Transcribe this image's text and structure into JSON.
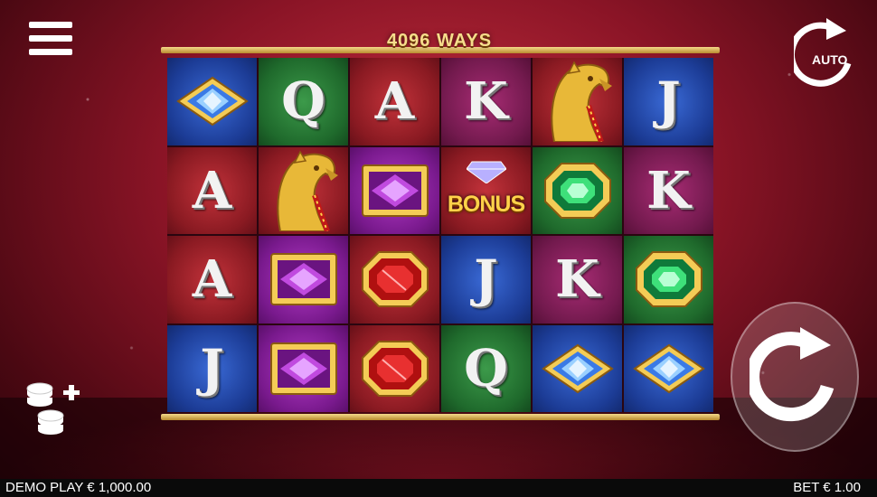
{
  "header": {
    "ways_label": "4096 WAYS"
  },
  "buttons": {
    "auto_label": "AUTO"
  },
  "colors": {
    "gold": "#f7dd8c",
    "background": "#8a1426",
    "status_bar": "#0a0a0a"
  },
  "icons": {
    "menu": "menu-icon",
    "auto": "auto-spin-icon",
    "spin": "spin-icon",
    "coins": "coins-plus-icon"
  },
  "reels": [
    [
      {
        "symbol": "diamond-blue",
        "bg": "blue"
      },
      {
        "symbol": "Q",
        "bg": "green"
      },
      {
        "symbol": "A",
        "bg": "red"
      },
      {
        "symbol": "K",
        "bg": "magenta"
      },
      {
        "symbol": "panther",
        "bg": "red"
      },
      {
        "symbol": "J",
        "bg": "blue"
      }
    ],
    [
      {
        "symbol": "A",
        "bg": "red"
      },
      {
        "symbol": "panther",
        "bg": "red"
      },
      {
        "symbol": "amethyst",
        "bg": "purple"
      },
      {
        "symbol": "BONUS",
        "bg": "red"
      },
      {
        "symbol": "emerald",
        "bg": "green"
      },
      {
        "symbol": "K",
        "bg": "magenta"
      }
    ],
    [
      {
        "symbol": "A",
        "bg": "red"
      },
      {
        "symbol": "amethyst",
        "bg": "purple"
      },
      {
        "symbol": "ruby",
        "bg": "red"
      },
      {
        "symbol": "J",
        "bg": "blue"
      },
      {
        "symbol": "K",
        "bg": "magenta"
      },
      {
        "symbol": "emerald",
        "bg": "green"
      }
    ],
    [
      {
        "symbol": "J",
        "bg": "blue"
      },
      {
        "symbol": "amethyst",
        "bg": "purple"
      },
      {
        "symbol": "ruby",
        "bg": "red"
      },
      {
        "symbol": "Q",
        "bg": "green"
      },
      {
        "symbol": "diamond-blue",
        "bg": "blue"
      },
      {
        "symbol": "diamond-blue",
        "bg": "blue"
      }
    ]
  ],
  "status": {
    "balance_text": "DEMO PLAY € 1,000.00",
    "bet_text": "BET € 1.00"
  }
}
